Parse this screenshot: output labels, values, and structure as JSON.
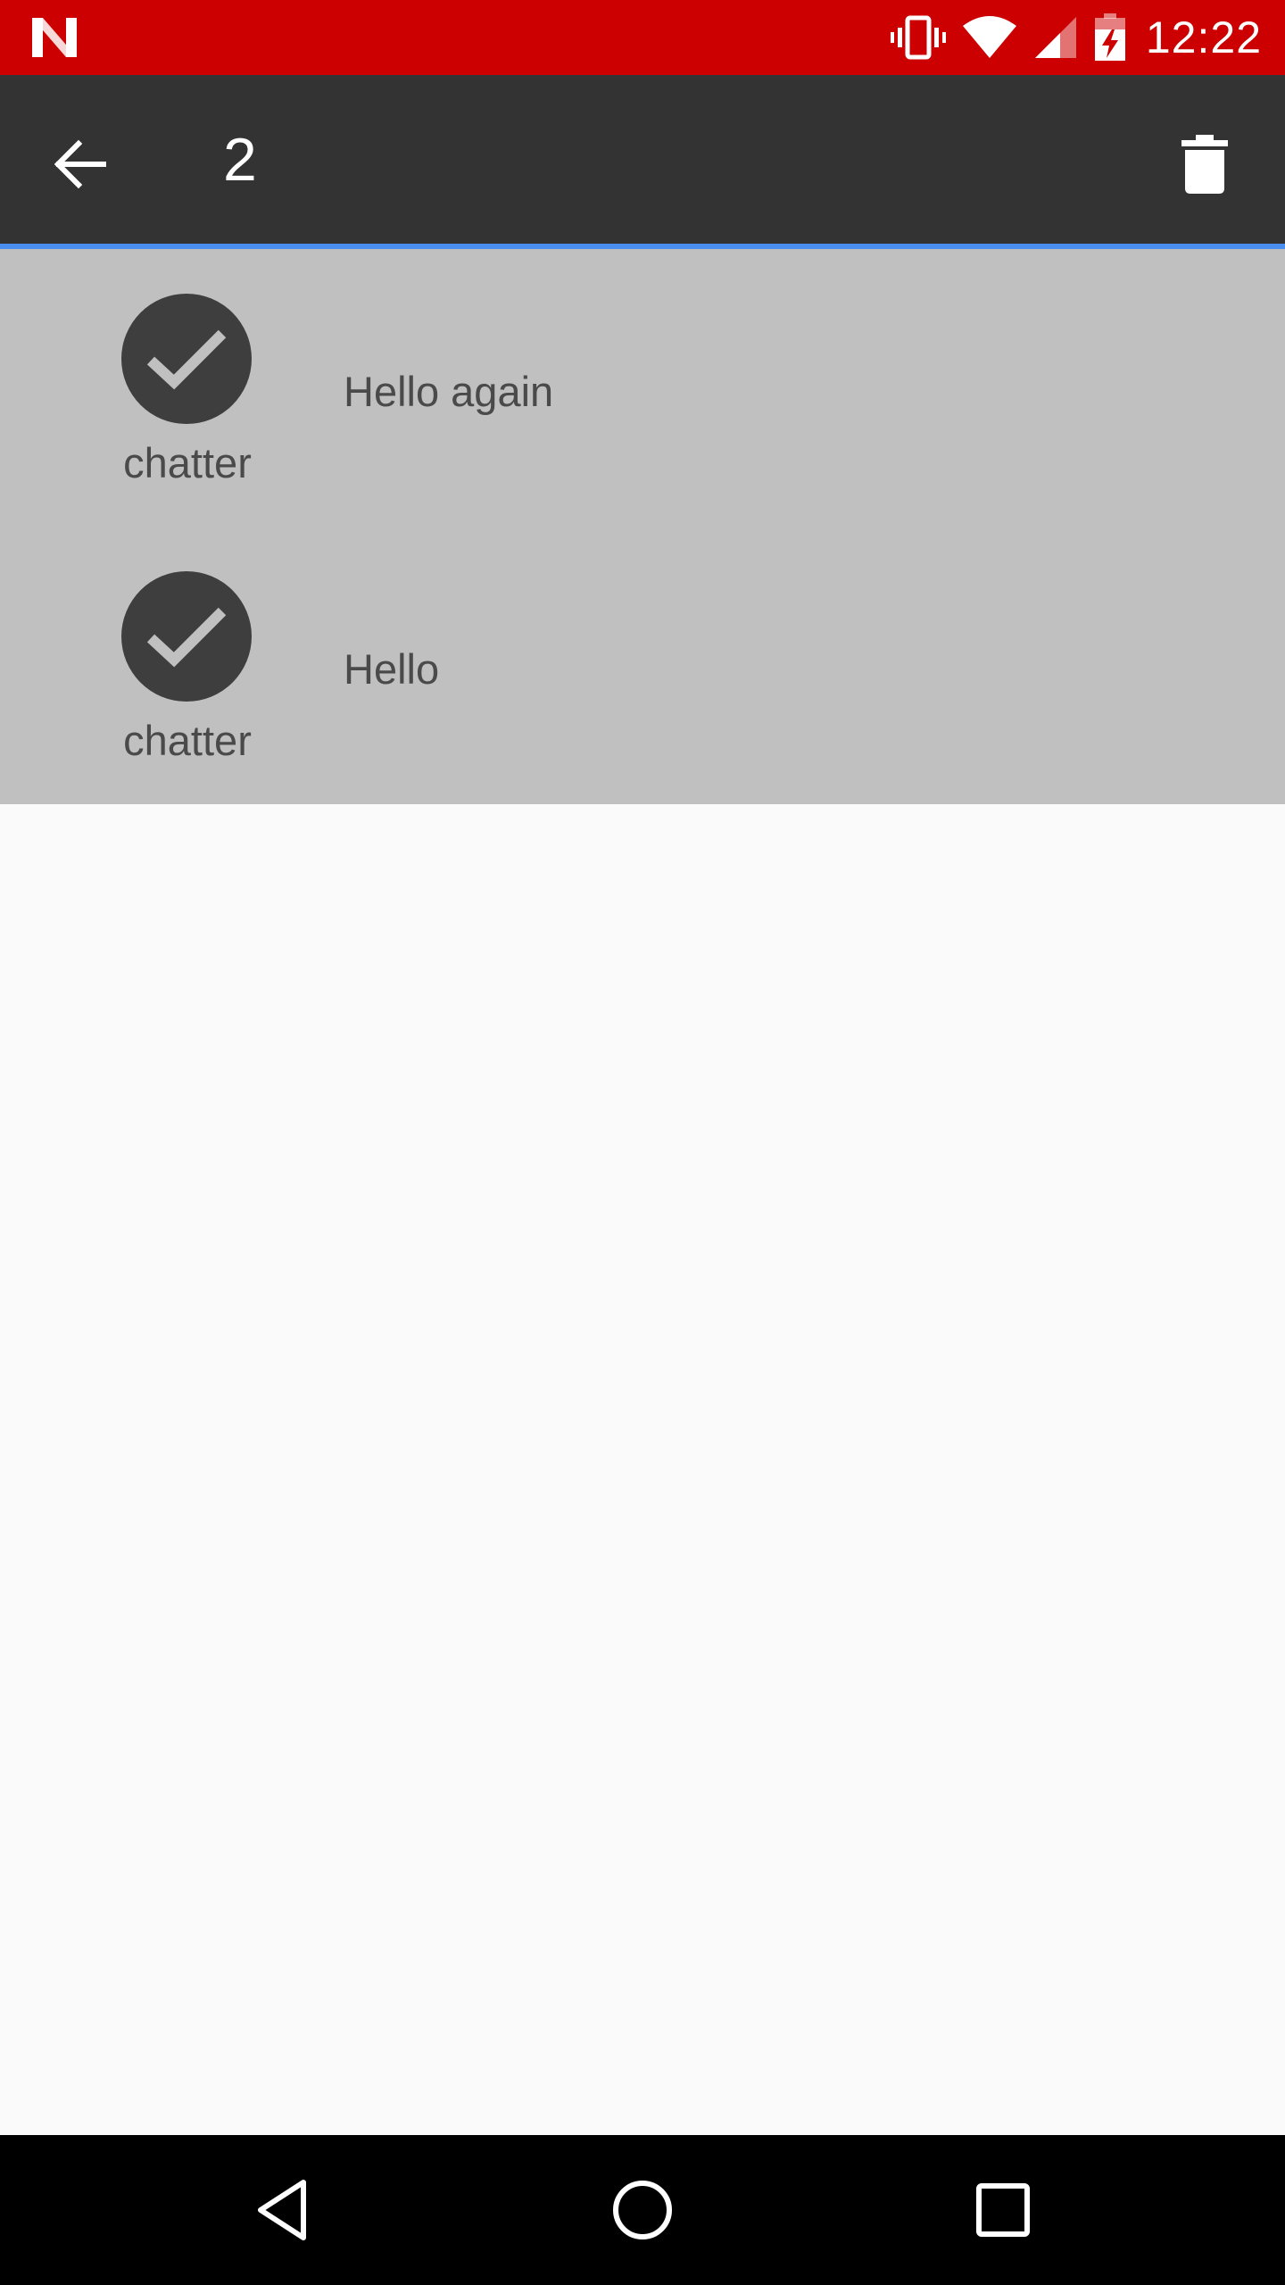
{
  "status_bar": {
    "time": "12:22",
    "background": "#cc0000",
    "icons": [
      "netflix-n-icon",
      "vibrate-icon",
      "wifi-icon",
      "signal-icon",
      "battery-charging-icon"
    ]
  },
  "toolbar": {
    "selected_count": "2",
    "background": "#333333",
    "accent": "#4a8ef0",
    "icons": [
      "back-arrow-icon",
      "trash-icon"
    ]
  },
  "messages": [
    {
      "sender": "chatter",
      "text": "Hello again",
      "selected": true
    },
    {
      "sender": "chatter",
      "text": "Hello",
      "selected": true
    }
  ],
  "colors": {
    "selected_row": "#c0c0c0",
    "avatar": "#3e3e3e",
    "check": "#c0c0c0",
    "page": "#fafafa"
  },
  "nav_bar": {
    "icons": [
      "nav-back-icon",
      "nav-home-icon",
      "nav-recents-icon"
    ]
  }
}
